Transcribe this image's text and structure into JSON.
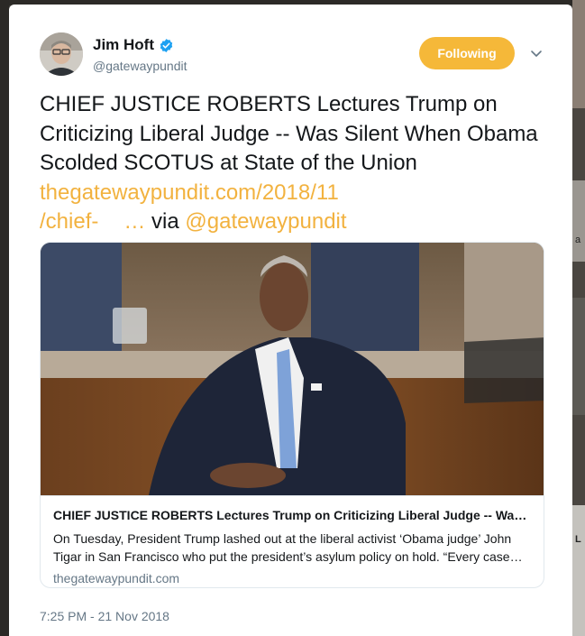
{
  "tweet": {
    "author_name": "Jim Hoft",
    "handle": "@gatewaypundit",
    "verified": true,
    "follow_button_label": "Following",
    "text_main": "CHIEF JUSTICE ROBERTS Lectures Trump on Criticizing Liberal Judge -- Was Silent When Obama Scolded SCOTUS at State of the Union",
    "link_line1": "thegatewaypundit.com/2018/11",
    "link_line2": "/chief-",
    "link_ellipsis": "…",
    "via_text": "via",
    "mention": "@gatewaypundit",
    "timestamp": "7:25 PM - 21 Nov 2018"
  },
  "link_card": {
    "title": "CHIEF JUSTICE ROBERTS Lectures Trump on Criticizing Liberal Judge -- Was Silent When Obama Scolded SCOTUS at State of the Union",
    "description": "On Tuesday, President Trump lashed out at the liberal activist ‘Obama judge’ John Tigar in San Francisco who put the president’s asylum policy on hold. “Every case that gets filed in the Ninth Circuit we get beaten”",
    "domain": "thegatewaypundit.com"
  },
  "background": {
    "right_glyph_1": "a",
    "right_glyph_2": "L"
  },
  "colors": {
    "link": "#f2b23f",
    "follow_button": "#f5b839",
    "verified_badge": "#1da1f2",
    "secondary_text": "#657786"
  },
  "icons": {
    "verified": "verified-badge-icon",
    "caret": "chevron-down-icon",
    "avatar": "avatar-photo",
    "card_image": "card-photo"
  }
}
